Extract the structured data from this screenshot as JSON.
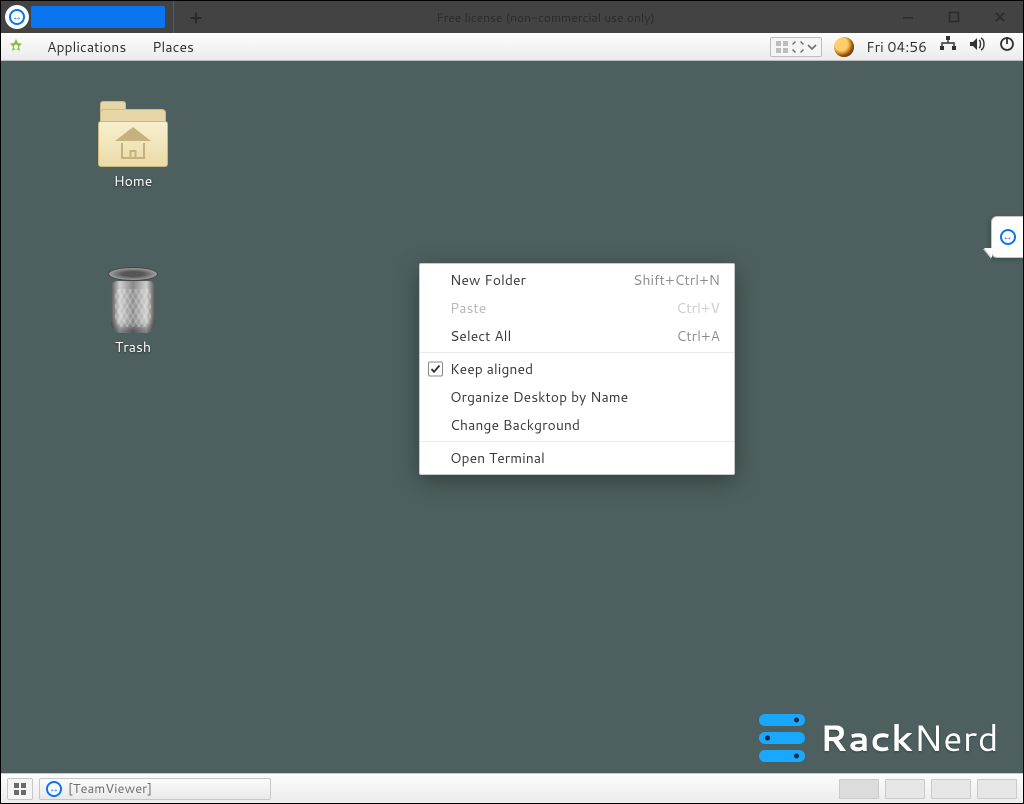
{
  "window": {
    "license_text": "Free license (non-commercial use only)"
  },
  "panel": {
    "applications_label": "Applications",
    "places_label": "Places",
    "clock": "Fri 04:56"
  },
  "desktop_icons": {
    "home_label": "Home",
    "trash_label": "Trash"
  },
  "context_menu": {
    "new_folder": {
      "label": "New Folder",
      "accel": "Shift+Ctrl+N"
    },
    "paste": {
      "label": "Paste",
      "accel": "Ctrl+V"
    },
    "select_all": {
      "label": "Select All",
      "accel": "Ctrl+A"
    },
    "keep_aligned": {
      "label": "Keep aligned"
    },
    "organize": {
      "label": "Organize Desktop by Name"
    },
    "change_bg": {
      "label": "Change Background"
    },
    "open_term": {
      "label": "Open Terminal"
    }
  },
  "taskbar": {
    "teamviewer_task": "[TeamViewer]"
  },
  "watermark": {
    "brand_a": "Rack",
    "brand_b": "Nerd"
  }
}
